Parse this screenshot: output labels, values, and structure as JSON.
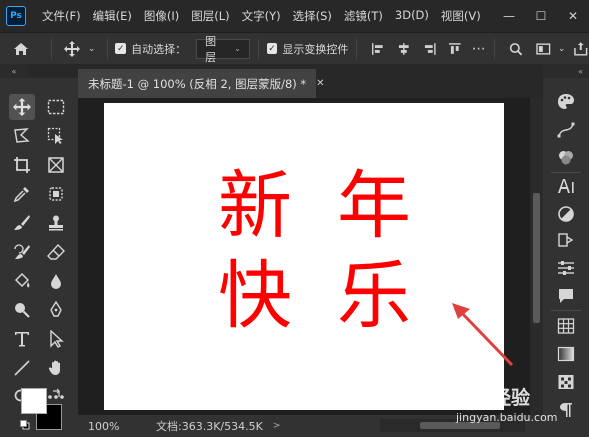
{
  "app": {
    "logo_text": "Ps"
  },
  "menubar": {
    "items": [
      "文件(F)",
      "编辑(E)",
      "图像(I)",
      "图层(L)",
      "文字(Y)",
      "选择(S)",
      "滤镜(T)",
      "3D(D)",
      "视图(V)"
    ]
  },
  "window_controls": {
    "minimize": "—",
    "maximize": "☐",
    "close": "✕"
  },
  "options": {
    "auto_select_checked": true,
    "auto_select_label": "自动选择：",
    "auto_select_target": "图层",
    "show_transform_checked": true,
    "show_transform_label": "显示变换控件"
  },
  "document": {
    "tab_title": "未标题-1 @ 100% (反相 2, 图层蒙版/8) *",
    "close_glyph": "✕",
    "canvas_chars": [
      "新",
      "年",
      "快",
      "乐"
    ],
    "text_color": "#ff0000"
  },
  "statusbar": {
    "zoom": "100%",
    "doc_info": "文档:363.3K/534.5K",
    "arrow": ">"
  },
  "panels": {
    "collapse_glyph": "«"
  },
  "colors": {
    "foreground": "#ffffff",
    "background": "#000000",
    "annotation": "#e04040"
  },
  "watermark": {
    "brand": "经验",
    "url": "jingyan.baidu.com"
  }
}
